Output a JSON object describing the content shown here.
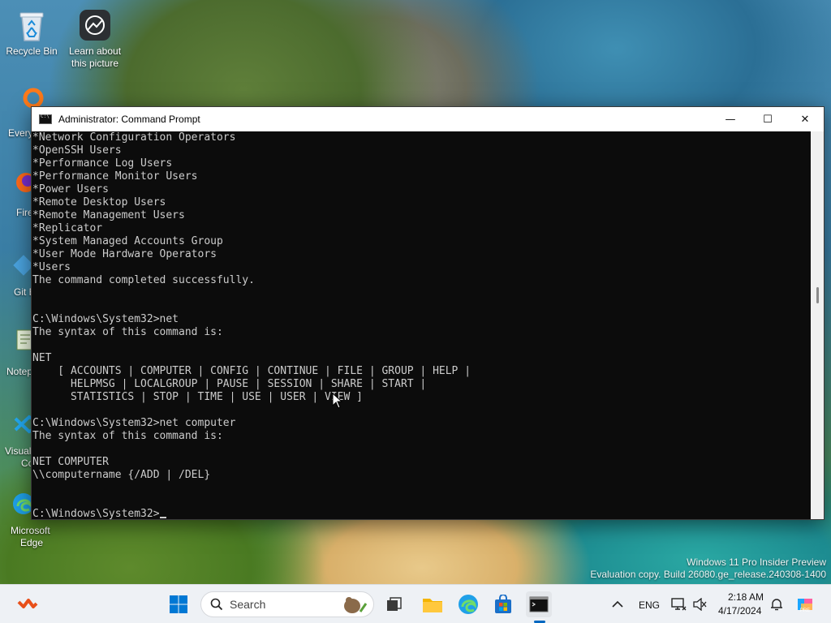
{
  "desktop": {
    "icons": [
      {
        "label": "Recycle Bin"
      },
      {
        "label": "Learn about this picture"
      }
    ],
    "partial_labels": [
      "Every",
      "Fire",
      "Git B",
      "Notep",
      "Visual",
      "Co",
      "Microsoft",
      "Edge"
    ],
    "watermark": {
      "line1": "Windows 11 Pro Insider Preview",
      "line2": "Evaluation copy. Build 26080.ge_release.240308-1400"
    }
  },
  "window": {
    "title": "Administrator: Command Prompt",
    "controls": {
      "minimize": "—",
      "maximize": "☐",
      "close": "✕"
    }
  },
  "console": {
    "lines": [
      "*Network Configuration Operators",
      "*OpenSSH Users",
      "*Performance Log Users",
      "*Performance Monitor Users",
      "*Power Users",
      "*Remote Desktop Users",
      "*Remote Management Users",
      "*Replicator",
      "*System Managed Accounts Group",
      "*User Mode Hardware Operators",
      "*Users",
      "The command completed successfully.",
      "",
      "",
      "C:\\Windows\\System32>net",
      "The syntax of this command is:",
      "",
      "NET",
      "    [ ACCOUNTS | COMPUTER | CONFIG | CONTINUE | FILE | GROUP | HELP |",
      "      HELPMSG | LOCALGROUP | PAUSE | SESSION | SHARE | START |",
      "      STATISTICS | STOP | TIME | USE | USER | VIEW ]",
      "",
      "C:\\Windows\\System32>net computer",
      "The syntax of this command is:",
      "",
      "NET COMPUTER",
      "\\\\computername {/ADD | /DEL}",
      "",
      "",
      "C:\\Windows\\System32>"
    ]
  },
  "taskbar": {
    "search_label": "Search",
    "language": "ENG",
    "time": "2:18 AM",
    "date": "4/17/2024",
    "colors": {
      "accent": "#0067c0",
      "start_blue": "#0078d4"
    }
  }
}
